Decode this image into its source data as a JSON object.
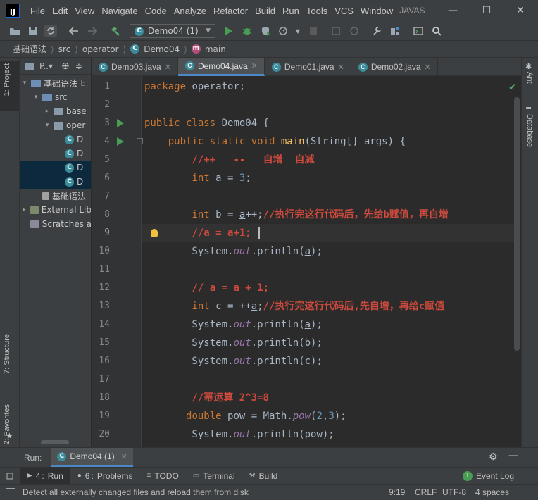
{
  "window": {
    "menu_items": [
      "File",
      "Edit",
      "View",
      "Navigate",
      "Code",
      "Analyze",
      "Refactor",
      "Build",
      "Run",
      "Tools",
      "VCS",
      "Window"
    ],
    "project_title": "JAVAS",
    "logo_text": "IJ"
  },
  "toolbar": {
    "run_config": "Demo04 (1)"
  },
  "breadcrumb": [
    "基础语法",
    "src",
    "operator",
    "Demo04",
    "main"
  ],
  "left_strip": {
    "project_tab": "1: Project",
    "structure_tab": "7: Structure",
    "favorites_tab": "2: Favorites"
  },
  "right_strip": {
    "ant_tab": "Ant",
    "database_tab": "Database"
  },
  "project_panel": {
    "header_label": "P..▾",
    "tree": [
      {
        "label": "基础语法",
        "suffix": "E:",
        "indent": 1,
        "type": "folder-blue",
        "arrow": "▾",
        "selected": false
      },
      {
        "label": "src",
        "indent": 2,
        "type": "folder-blue",
        "arrow": "▾",
        "selected": false
      },
      {
        "label": "base",
        "indent": 3,
        "type": "folder",
        "arrow": "▸",
        "selected": false
      },
      {
        "label": "oper",
        "indent": 3,
        "type": "folder",
        "arrow": "▾",
        "selected": false
      },
      {
        "label": "D",
        "indent": 4,
        "type": "class",
        "arrow": "",
        "selected": false
      },
      {
        "label": "D",
        "indent": 4,
        "type": "class",
        "arrow": "",
        "selected": false
      },
      {
        "label": "D",
        "indent": 4,
        "type": "class",
        "arrow": "",
        "selected": true
      },
      {
        "label": "D",
        "indent": 4,
        "type": "class",
        "arrow": "",
        "selected": true
      },
      {
        "label": "基础语法",
        "indent": 2,
        "type": "file",
        "arrow": "",
        "selected": false
      },
      {
        "label": "External Lib",
        "indent": 1,
        "type": "lib",
        "arrow": "▸",
        "selected": false
      },
      {
        "label": "Scratches a",
        "indent": 1,
        "type": "scratch",
        "arrow": "",
        "selected": false
      }
    ]
  },
  "tabs": [
    {
      "label": "Demo03.java",
      "active": false
    },
    {
      "label": "Demo04.java",
      "active": true
    },
    {
      "label": "Demo01.java",
      "active": false
    },
    {
      "label": "Demo02.java",
      "active": false
    }
  ],
  "editor": {
    "current_line": 9,
    "lines": [
      {
        "n": "1",
        "html": "<span class='kw'>package</span> operator;"
      },
      {
        "n": "2",
        "html": ""
      },
      {
        "n": "3",
        "html": "<span class='kw'>public class</span> Demo04 {"
      },
      {
        "n": "4",
        "html": "    <span class='kw'>public static void</span> <span class='fn'>main</span>(String[] args) {"
      },
      {
        "n": "5",
        "html": "        <span class='cm'>//++   --   自增  自减</span>"
      },
      {
        "n": "6",
        "html": "        <span class='kw'>int</span> <span class='var'>a</span> = <span class='num'>3</span>;"
      },
      {
        "n": "7",
        "html": ""
      },
      {
        "n": "8",
        "html": "        <span class='kw'>int</span> b = <span class='var'>a</span>++;<span class='cm'>//执行完这行代码后，先给b赋值，再自增</span>"
      },
      {
        "n": "9",
        "html": "        <span class='cm'>//a = a+1;</span>"
      },
      {
        "n": "10",
        "html": "        System.<span class='fld'>out</span>.println(<span class='var'>a</span>);"
      },
      {
        "n": "11",
        "html": ""
      },
      {
        "n": "12",
        "html": "        <span class='cm'>// a = a + 1;</span>"
      },
      {
        "n": "13",
        "html": "        <span class='kw'>int</span> c = ++<span class='var'>a</span>;<span class='cm'>//执行完这行代码后,先自增，再给c赋值</span>"
      },
      {
        "n": "14",
        "html": "        System.<span class='fld'>out</span>.println(<span class='var'>a</span>);"
      },
      {
        "n": "15",
        "html": "        System.<span class='fld'>out</span>.println(b);"
      },
      {
        "n": "16",
        "html": "        System.<span class='fld'>out</span>.println(c);"
      },
      {
        "n": "17",
        "html": ""
      },
      {
        "n": "18",
        "html": "        <span class='cm'>//幂运算 2^3=8</span>"
      },
      {
        "n": "19",
        "html": "       <span class='kw'>double</span> pow = Math.<span class='fld'>pow</span>(<span class='num'>2</span>,<span class='num'>3</span>);"
      },
      {
        "n": "20",
        "html": "        System.<span class='fld'>out</span>.println(pow);"
      }
    ]
  },
  "run_panel": {
    "label": "Run:",
    "config_tab": "Demo04 (1)"
  },
  "bottom_tabs": [
    {
      "key": "4",
      "label": "Run",
      "active": true
    },
    {
      "key": "6",
      "label": "Problems",
      "active": false
    },
    {
      "key": "",
      "label": "TODO",
      "active": false
    },
    {
      "key": "",
      "label": "Terminal",
      "active": false
    },
    {
      "key": "",
      "label": "Build",
      "active": false
    }
  ],
  "event_log": {
    "count": "1",
    "label": "Event Log"
  },
  "status": {
    "message": "Detect all externally changed files and reload them from disk",
    "position": "9:19",
    "line_sep": "CRLF",
    "encoding": "UTF-8",
    "indent": "4 spaces"
  },
  "colors": {
    "accent": "#4a88c7",
    "run_green": "#499c54",
    "comment_red": "#cc4a3d"
  }
}
